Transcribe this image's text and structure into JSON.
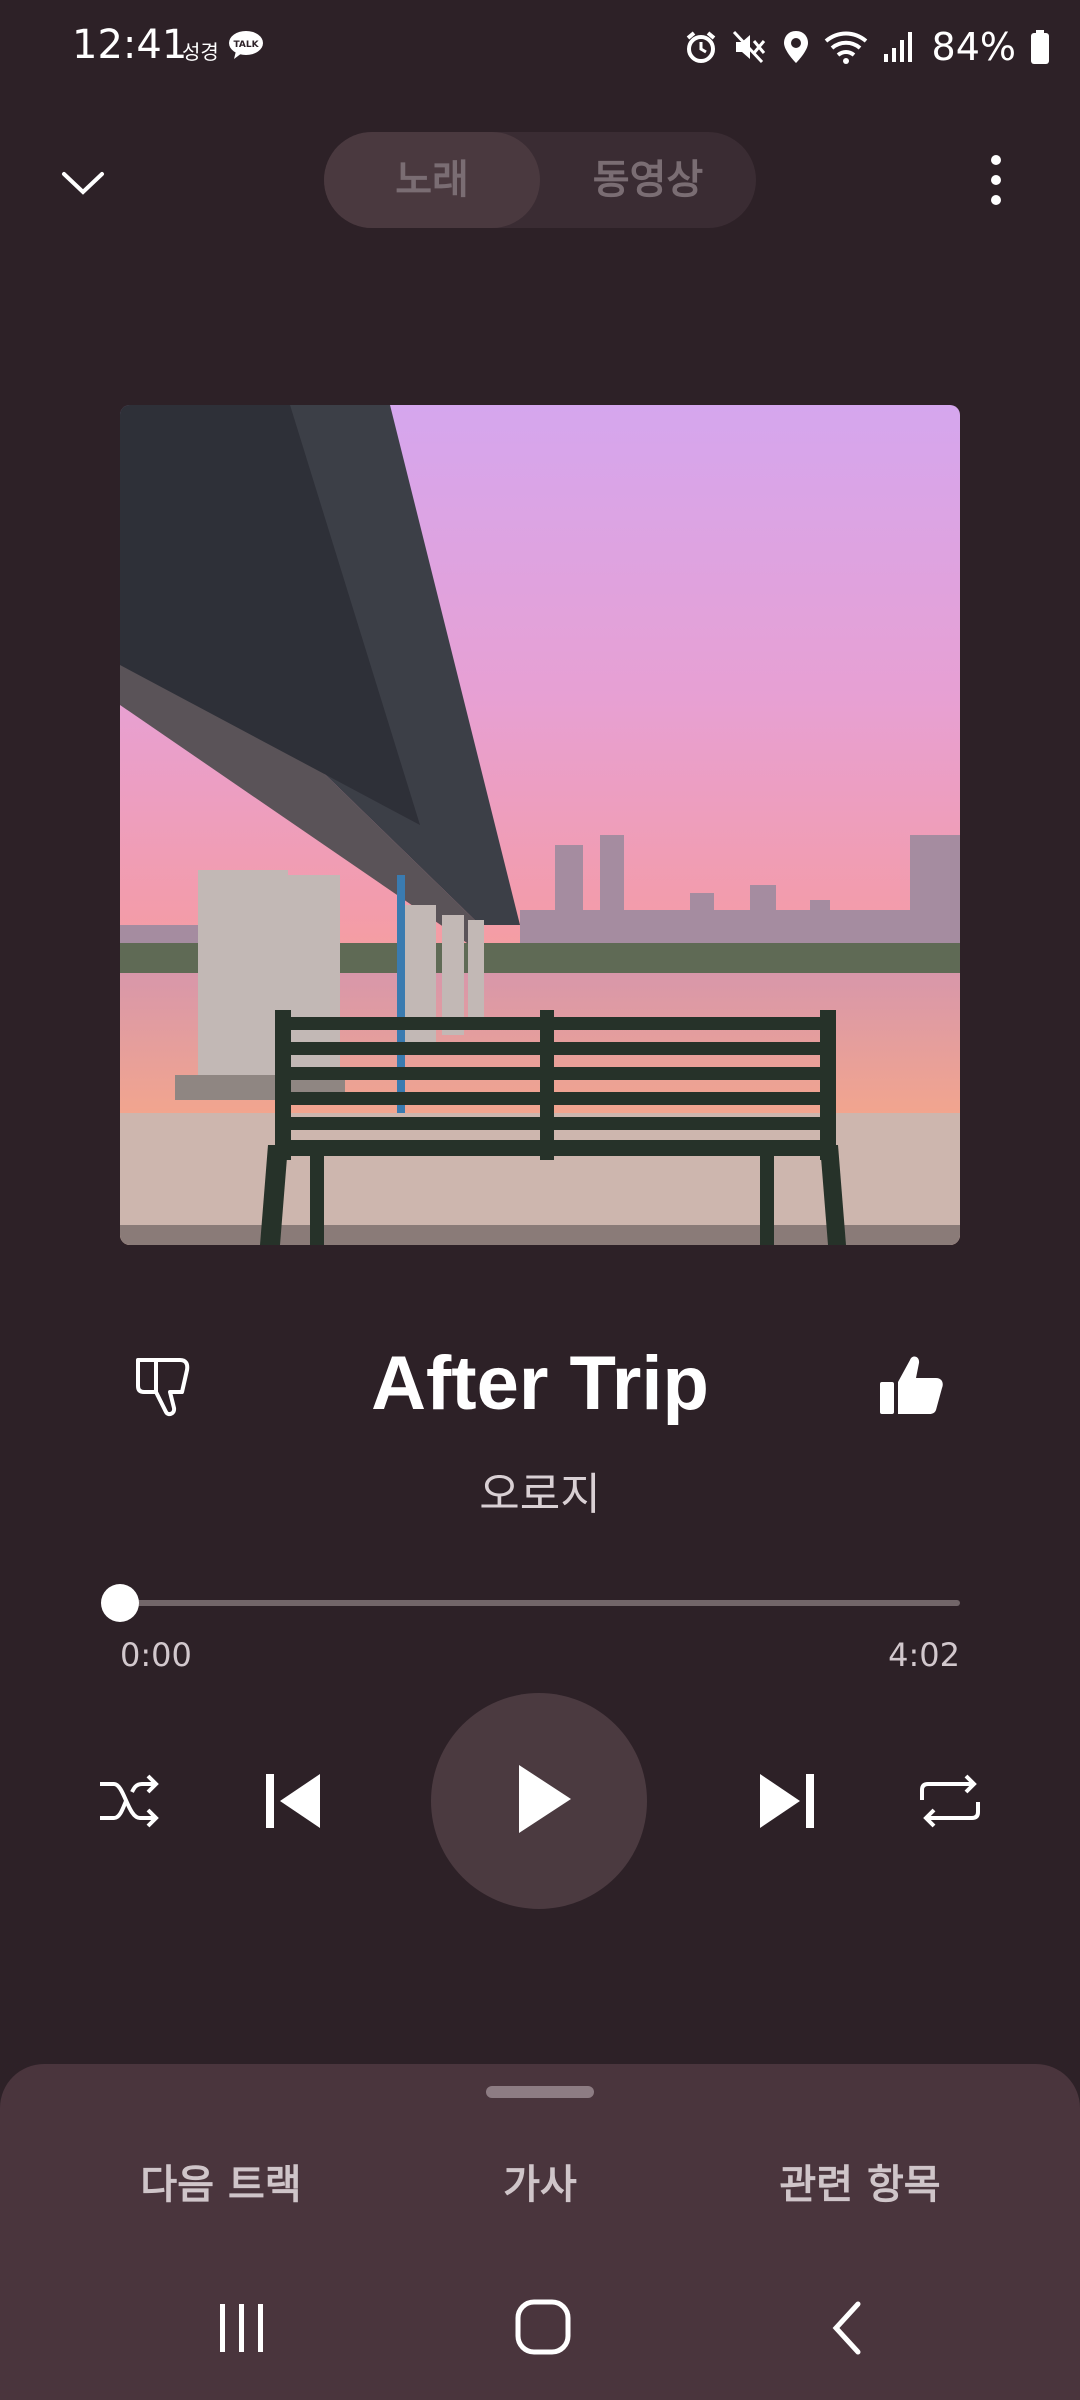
{
  "status_bar": {
    "time": "12:41",
    "small_text": "성경",
    "talk_label": "TALK",
    "battery": "84%"
  },
  "header": {
    "tabs": [
      {
        "label": "노래",
        "active": true
      },
      {
        "label": "동영상",
        "active": false
      }
    ]
  },
  "track": {
    "title": "After Trip",
    "artist": "오로지",
    "elapsed": "0:00",
    "duration": "4:02",
    "progress": 0.0
  },
  "bottom_sheet": {
    "tabs": [
      "다음 트랙",
      "가사",
      "관련 항목"
    ]
  },
  "colors": {
    "background": "#2d2127",
    "sheet": "#4a353d",
    "play_circle": "#4b3a40"
  },
  "icons": {
    "collapse": "chevron-down-icon",
    "more": "more-vertical-icon",
    "dislike": "thumbs-down-icon",
    "like": "thumbs-up-icon",
    "shuffle": "shuffle-icon",
    "previous": "skip-previous-icon",
    "play": "play-icon",
    "next": "skip-next-icon",
    "repeat": "repeat-icon"
  }
}
